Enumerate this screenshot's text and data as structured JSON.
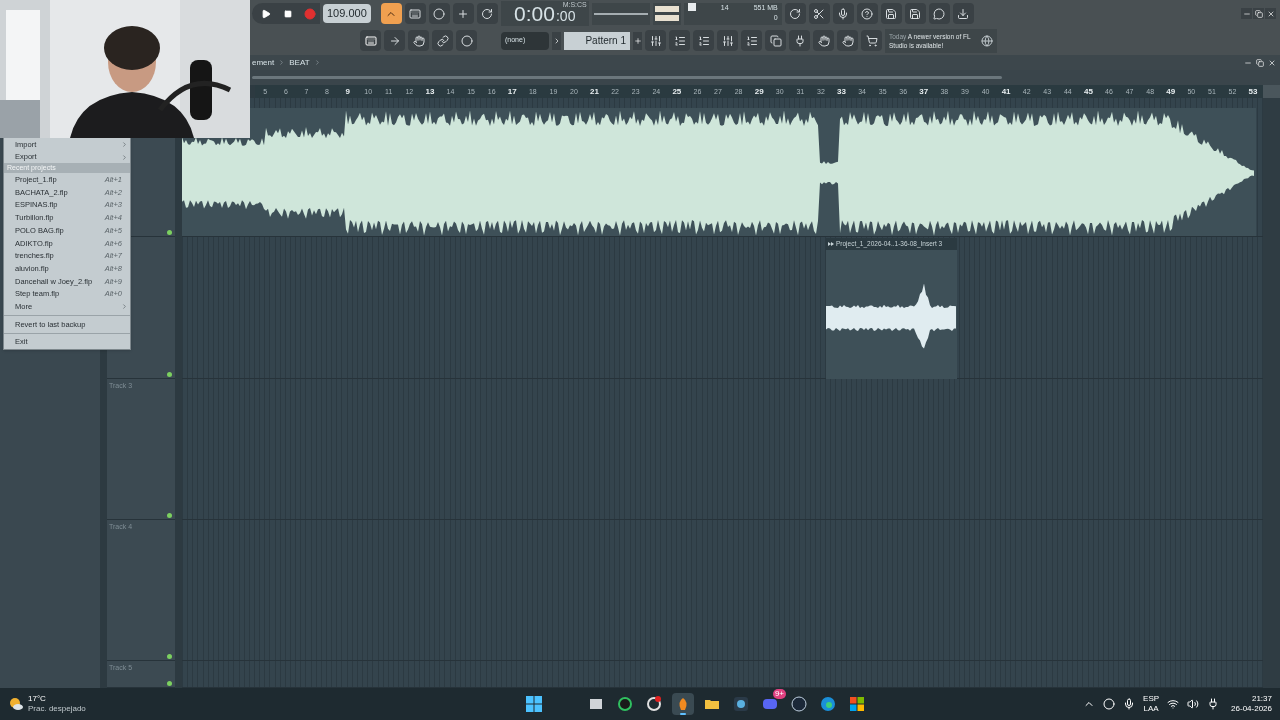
{
  "toolbar": {
    "tempo": "109.000",
    "time": "0:00",
    "time_cs": ":00",
    "time_format": "M:S:CS",
    "cpu": "14",
    "memory": "551 MB",
    "polyphony": "0",
    "pattern_selector": "(none)",
    "pattern": "Pattern 1",
    "news_date": "Today",
    "news_text": "A newer version of FL Studio is available!",
    "typing_keyboard": true
  },
  "breadcrumb": [
    "ement",
    "BEAT"
  ],
  "ruler": [
    {
      "label": "5",
      "major": false
    },
    {
      "label": "6",
      "major": false
    },
    {
      "label": "7",
      "major": false
    },
    {
      "label": "8",
      "major": false
    },
    {
      "label": "9",
      "major": true
    },
    {
      "label": "10",
      "major": false
    },
    {
      "label": "11",
      "major": false
    },
    {
      "label": "12",
      "major": false
    },
    {
      "label": "13",
      "major": true
    },
    {
      "label": "14",
      "major": false
    },
    {
      "label": "15",
      "major": false
    },
    {
      "label": "16",
      "major": false
    },
    {
      "label": "17",
      "major": true
    },
    {
      "label": "18",
      "major": false
    },
    {
      "label": "19",
      "major": false
    },
    {
      "label": "20",
      "major": false
    },
    {
      "label": "21",
      "major": true
    },
    {
      "label": "22",
      "major": false
    },
    {
      "label": "23",
      "major": false
    },
    {
      "label": "24",
      "major": false
    },
    {
      "label": "25",
      "major": true
    },
    {
      "label": "26",
      "major": false
    },
    {
      "label": "27",
      "major": false
    },
    {
      "label": "28",
      "major": false
    },
    {
      "label": "29",
      "major": true
    },
    {
      "label": "30",
      "major": false
    },
    {
      "label": "31",
      "major": false
    },
    {
      "label": "32",
      "major": false
    },
    {
      "label": "33",
      "major": true
    },
    {
      "label": "34",
      "major": false
    },
    {
      "label": "35",
      "major": false
    },
    {
      "label": "36",
      "major": false
    },
    {
      "label": "37",
      "major": true
    },
    {
      "label": "38",
      "major": false
    },
    {
      "label": "39",
      "major": false
    },
    {
      "label": "40",
      "major": false
    },
    {
      "label": "41",
      "major": true
    },
    {
      "label": "42",
      "major": false
    },
    {
      "label": "43",
      "major": false
    },
    {
      "label": "44",
      "major": false
    },
    {
      "label": "45",
      "major": true
    },
    {
      "label": "46",
      "major": false
    },
    {
      "label": "47",
      "major": false
    },
    {
      "label": "48",
      "major": false
    },
    {
      "label": "49",
      "major": true
    },
    {
      "label": "50",
      "major": false
    },
    {
      "label": "51",
      "major": false
    },
    {
      "label": "52",
      "major": false
    },
    {
      "label": "53",
      "major": true
    }
  ],
  "tracks": [
    {
      "kind": "full-clip"
    },
    {
      "kind": "titled-clip",
      "clip_title": "Project_1_2026-04..1-36-08_Insert 3"
    },
    {
      "kind": "empty",
      "label": "Track 3"
    },
    {
      "kind": "empty",
      "label": "Track 4"
    },
    {
      "kind": "empty",
      "label": "Track 5"
    }
  ],
  "file_menu": {
    "items": [
      {
        "kind": "submenu",
        "label": "Import"
      },
      {
        "kind": "submenu",
        "label": "Export"
      },
      {
        "kind": "header",
        "label": "Recent projects"
      },
      {
        "kind": "item",
        "label": "Project_1.flp",
        "shortcut": "Alt+1"
      },
      {
        "kind": "item",
        "label": "BACHATA_2.flp",
        "shortcut": "Alt+2"
      },
      {
        "kind": "item",
        "label": "ESPINAS.flp",
        "shortcut": "Alt+3"
      },
      {
        "kind": "item",
        "label": "Turbillon.flp",
        "shortcut": "Alt+4"
      },
      {
        "kind": "item",
        "label": "POLO BAG.flp",
        "shortcut": "Alt+5"
      },
      {
        "kind": "item",
        "label": "ADIKTO.flp",
        "shortcut": "Alt+6"
      },
      {
        "kind": "item",
        "label": "trenches.flp",
        "shortcut": "Alt+7"
      },
      {
        "kind": "item",
        "label": "aluvion.flp",
        "shortcut": "Alt+8"
      },
      {
        "kind": "item",
        "label": "Dancehall w Joey_2.flp",
        "shortcut": "Alt+9"
      },
      {
        "kind": "item",
        "label": "Step team.flp",
        "shortcut": "Alt+0"
      },
      {
        "kind": "submenu",
        "label": "More"
      },
      {
        "kind": "separator"
      },
      {
        "kind": "item",
        "label": "Revert to last backup"
      },
      {
        "kind": "separator"
      },
      {
        "kind": "item",
        "label": "Exit"
      }
    ]
  },
  "taskbar": {
    "temperature": "17°C",
    "weather": "Prac. despejado",
    "apps": [
      {
        "kind": "start",
        "selected": false
      },
      {
        "kind": "window",
        "selected": false
      },
      {
        "kind": "ring",
        "selected": false
      },
      {
        "kind": "chrome-dot",
        "selected": false
      },
      {
        "kind": "fruit",
        "selected": true
      },
      {
        "kind": "folder",
        "selected": false
      },
      {
        "kind": "editor",
        "selected": false
      },
      {
        "kind": "chat",
        "selected": false,
        "badge": "9+"
      },
      {
        "kind": "steam",
        "selected": false
      },
      {
        "kind": "browser",
        "selected": false
      },
      {
        "kind": "store",
        "selected": false
      }
    ],
    "language": "ESP",
    "layout": "LAA",
    "clock": "21:37",
    "date": "26-04-2026"
  }
}
